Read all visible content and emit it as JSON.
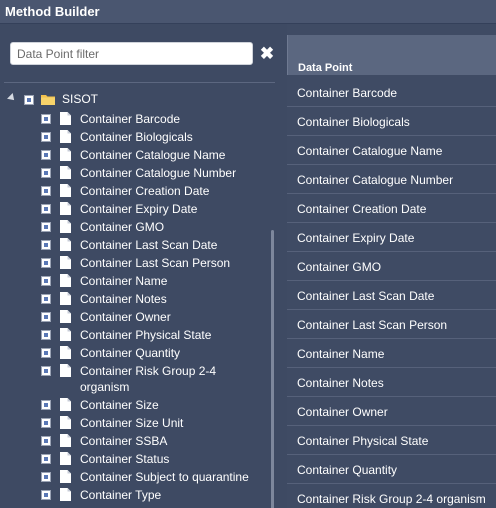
{
  "window": {
    "title": "Method Builder"
  },
  "filter": {
    "placeholder": "Data Point filter",
    "value": "",
    "clear_icon": "close-icon"
  },
  "tree": {
    "root": {
      "label": "SISOT",
      "expanded": true,
      "icon": "folder-icon"
    },
    "items": [
      {
        "label": "Container Barcode"
      },
      {
        "label": "Container Biologicals"
      },
      {
        "label": "Container Catalogue Name"
      },
      {
        "label": "Container Catalogue Number"
      },
      {
        "label": "Container Creation Date"
      },
      {
        "label": "Container Expiry Date"
      },
      {
        "label": "Container GMO"
      },
      {
        "label": "Container Last Scan Date"
      },
      {
        "label": "Container Last Scan Person"
      },
      {
        "label": "Container Name"
      },
      {
        "label": "Container Notes"
      },
      {
        "label": "Container Owner"
      },
      {
        "label": "Container Physical State"
      },
      {
        "label": "Container Quantity"
      },
      {
        "label": "Container Risk Group 2-4 organism"
      },
      {
        "label": "Container Size"
      },
      {
        "label": "Container Size Unit"
      },
      {
        "label": "Container SSBA"
      },
      {
        "label": "Container Status"
      },
      {
        "label": "Container Subject to quarantine"
      },
      {
        "label": "Container Type"
      }
    ]
  },
  "grid": {
    "header": "Data Point",
    "rows": [
      "Container Barcode",
      "Container Biologicals",
      "Container Catalogue Name",
      "Container Catalogue Number",
      "Container Creation Date",
      "Container Expiry Date",
      "Container GMO",
      "Container Last Scan Date",
      "Container Last Scan Person",
      "Container Name",
      "Container Notes",
      "Container Owner",
      "Container Physical State",
      "Container Quantity",
      "Container Risk Group 2-4 organism"
    ]
  },
  "colors": {
    "background": "#3e4a63",
    "header": "#5b6780",
    "checkbox_fill": "#5a78b5",
    "folder": "#f2c14e"
  }
}
